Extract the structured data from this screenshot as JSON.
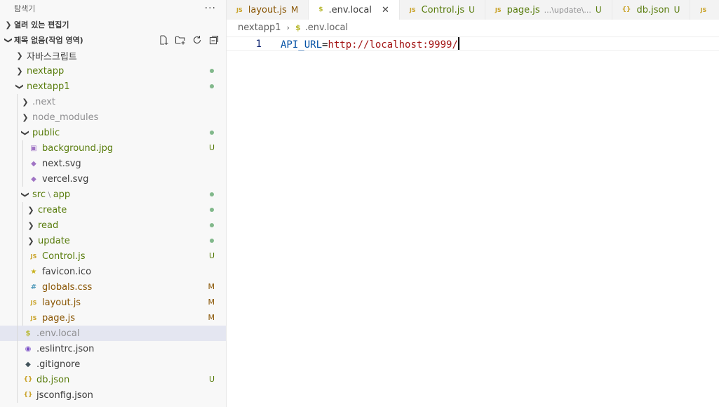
{
  "explorer": {
    "title": "탐색기",
    "more": "···",
    "open_editors": {
      "label": "열려 있는 편집기"
    },
    "workspace": {
      "label": "제목 없음(작업 영역)"
    }
  },
  "tree": [
    {
      "label": "자바스크립트",
      "depth": 0,
      "kind": "folder",
      "open": false,
      "color": "dark"
    },
    {
      "label": "nextapp",
      "depth": 0,
      "kind": "folder",
      "open": false,
      "color": "green",
      "dot": true
    },
    {
      "label": "nextapp1",
      "depth": 0,
      "kind": "folder",
      "open": true,
      "color": "green",
      "dot": true
    },
    {
      "label": ".next",
      "depth": 1,
      "kind": "folder",
      "open": false,
      "color": "gray"
    },
    {
      "label": "node_modules",
      "depth": 1,
      "kind": "folder",
      "open": false,
      "color": "gray"
    },
    {
      "label": "public",
      "depth": 1,
      "kind": "folder",
      "open": true,
      "color": "green",
      "dot": true
    },
    {
      "label": "background.jpg",
      "depth": 2,
      "kind": "file",
      "icon": "image-icon",
      "glyph": "▣",
      "iclass": "ic-img",
      "color": "green",
      "badge": "U"
    },
    {
      "label": "next.svg",
      "depth": 2,
      "kind": "file",
      "icon": "svg-file-icon",
      "glyph": "◆",
      "iclass": "ic-svg",
      "color": "dark"
    },
    {
      "label": "vercel.svg",
      "depth": 2,
      "kind": "file",
      "icon": "svg-file-icon",
      "glyph": "◆",
      "iclass": "ic-svg",
      "color": "dark"
    },
    {
      "label": "src",
      "label2": "app",
      "depth": 1,
      "kind": "folder",
      "open": true,
      "color": "green",
      "dot": true
    },
    {
      "label": "create",
      "depth": 2,
      "kind": "folder",
      "open": false,
      "color": "green",
      "dot": true
    },
    {
      "label": "read",
      "depth": 2,
      "kind": "folder",
      "open": false,
      "color": "green",
      "dot": true
    },
    {
      "label": "update",
      "depth": 2,
      "kind": "folder",
      "open": false,
      "color": "green",
      "dot": true
    },
    {
      "label": "Control.js",
      "depth": 2,
      "kind": "file",
      "icon": "js-file-icon",
      "glyph": "JS",
      "iclass": "ic-js",
      "color": "green",
      "badge": "U"
    },
    {
      "label": "favicon.ico",
      "depth": 2,
      "kind": "file",
      "icon": "star-icon",
      "glyph": "★",
      "iclass": "ic-star",
      "color": "dark"
    },
    {
      "label": "globals.css",
      "depth": 2,
      "kind": "file",
      "icon": "css-file-icon",
      "glyph": "#",
      "iclass": "ic-css",
      "color": "yellow",
      "badge": "M"
    },
    {
      "label": "layout.js",
      "depth": 2,
      "kind": "file",
      "icon": "js-file-icon",
      "glyph": "JS",
      "iclass": "ic-js",
      "color": "yellow",
      "badge": "M"
    },
    {
      "label": "page.js",
      "depth": 2,
      "kind": "file",
      "icon": "js-file-icon",
      "glyph": "JS",
      "iclass": "ic-js",
      "color": "yellow",
      "badge": "M"
    },
    {
      "label": ".env.local",
      "depth": 1,
      "kind": "file",
      "icon": "dollar-icon",
      "glyph": "$",
      "iclass": "ic-dollar",
      "color": "gray",
      "selected": true
    },
    {
      "label": ".eslintrc.json",
      "depth": 1,
      "kind": "file",
      "icon": "eslint-icon",
      "glyph": "◉",
      "iclass": "ic-eslint",
      "color": "dark"
    },
    {
      "label": ".gitignore",
      "depth": 1,
      "kind": "file",
      "icon": "git-icon",
      "glyph": "◆",
      "iclass": "ic-git",
      "color": "dark"
    },
    {
      "label": "db.json",
      "depth": 1,
      "kind": "file",
      "icon": "json-file-icon",
      "glyph": "{}",
      "iclass": "ic-json",
      "color": "green",
      "badge": "U"
    },
    {
      "label": "jsconfig.json",
      "depth": 1,
      "kind": "file",
      "icon": "json-file-icon",
      "glyph": "{}",
      "iclass": "ic-json",
      "color": "dark"
    }
  ],
  "tabs": [
    {
      "label": "layout.js",
      "icon": "js-file-icon",
      "glyph": "JS",
      "iclass": "ic-js",
      "color": "yellow",
      "status": "M"
    },
    {
      "label": ".env.local",
      "icon": "dollar-icon",
      "glyph": "$",
      "iclass": "ic-dollar",
      "color": "gray",
      "active": true,
      "close": "✕"
    },
    {
      "label": "Control.js",
      "icon": "js-file-icon",
      "glyph": "JS",
      "iclass": "ic-js",
      "color": "green",
      "status": "U"
    },
    {
      "label": "page.js",
      "desc": "...\\update\\...",
      "icon": "js-file-icon",
      "glyph": "JS",
      "iclass": "ic-js",
      "color": "green",
      "status": "U"
    },
    {
      "label": "db.json",
      "icon": "json-file-icon",
      "glyph": "{}",
      "iclass": "ic-json",
      "color": "green",
      "status": "U"
    },
    {
      "label": "",
      "icon": "js-file-icon",
      "glyph": "JS",
      "iclass": "ic-js",
      "color": "green"
    }
  ],
  "breadcrumb": {
    "folder": "nextapp1",
    "sep": "›",
    "icon": "$",
    "file": ".env.local"
  },
  "editor": {
    "line_number": "1",
    "key": "API_URL",
    "op": "=",
    "value": "http://localhost:9999/"
  }
}
